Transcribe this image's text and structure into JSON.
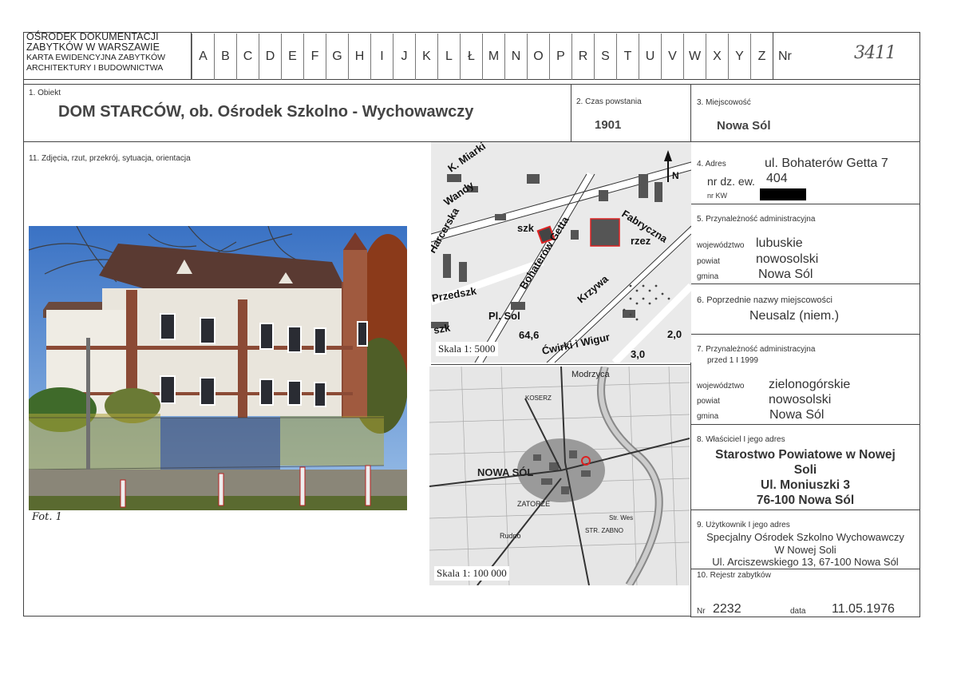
{
  "header": {
    "title_lines": [
      "OŚRODEK DOKUMENTACJI",
      "ZABYTKÓW W WARSZAWIE",
      "KARTA EWIDENCYJNA ZABYTKÓW",
      "ARCHITEKTURY I BUDOWNICTWA"
    ],
    "letters": [
      "A",
      "B",
      "C",
      "D",
      "E",
      "F",
      "G",
      "H",
      "I",
      "J",
      "K",
      "L",
      "Ł",
      "M",
      "N",
      "O",
      "P",
      "R",
      "S",
      "T",
      "U",
      "V",
      "W",
      "X",
      "Y",
      "Z"
    ],
    "nr_label": "Nr",
    "nr_handwritten": "3411"
  },
  "object": {
    "label": "1. Obiekt",
    "value": "DOM STARCÓW, ob. Ośrodek Szkolno - Wychowawczy"
  },
  "time": {
    "label": "2. Czas powstania",
    "value": "1901"
  },
  "locality": {
    "label": "3. Miejscowość",
    "value": "Nowa Sól"
  },
  "photos": {
    "label": "11. Zdjęcia, rzut, przekrój, sytuacja, orientacja",
    "caption": "Fot. 1"
  },
  "maps": {
    "top": {
      "scale": "Skala 1: 5000",
      "north": "N",
      "streets": [
        "Bohaterów Getta",
        "Fabryczna",
        "Krzywa",
        "Wandy",
        "K. Miarki",
        "Harcerska",
        "Przedszk",
        "szk",
        "szk",
        "rzez",
        "Pl. Sol",
        "Ćwirki i Wigur"
      ],
      "numbers": [
        "64,6",
        "2,0",
        "3,0"
      ]
    },
    "bottom": {
      "scale": "Skala 1: 100 000",
      "places": [
        "Modrzyca",
        "NOWA SÓL",
        "KOSERZ",
        "ZATORZE",
        "STR. ZABNO",
        "Rudno",
        "Str. Wes"
      ]
    }
  },
  "address": {
    "label": "4. Adres",
    "street": "ul. Bohaterów Getta 7",
    "plot_label": "nr dz. ew.",
    "plot_value": "404",
    "kw_label": "nr KW",
    "kw_value": ""
  },
  "admin": {
    "label": "5. Przynależność administracyjna",
    "voiv_label": "województwo",
    "voiv": "lubuskie",
    "powiat_label": "powiat",
    "powiat": "nowosolski",
    "gmina_label": "gmina",
    "gmina": "Nowa Sól"
  },
  "previous": {
    "label": "6. Poprzednie nazwy miejscowości",
    "value": "Neusalz (niem.)"
  },
  "admin_old": {
    "label1": "7. Przynależność administracyjna",
    "label2": "przed 1 I 1999",
    "voiv_label": "województwo",
    "voiv": "zielonogórskie",
    "powiat_label": "powiat",
    "powiat": "nowosolski",
    "gmina_label": "gmina",
    "gmina": "Nowa Sól"
  },
  "owner": {
    "label": "8. Właściciel I jego adres",
    "lines": [
      "Starostwo Powiatowe w Nowej",
      "Soli",
      "Ul. Moniuszki 3",
      "76-100 Nowa Sól"
    ]
  },
  "user": {
    "label": "9. Użytkownik I jego adres",
    "lines": [
      "Specjalny Ośrodek Szkolno Wychowawczy",
      "W Nowej Soli",
      "Ul. Arciszewskiego 13, 67-100 Nowa Sól"
    ]
  },
  "registry": {
    "label": "10. Rejestr zabytków",
    "nr_label": "Nr",
    "nr": "2232",
    "date_label": "data",
    "date": "11.05.1976"
  }
}
